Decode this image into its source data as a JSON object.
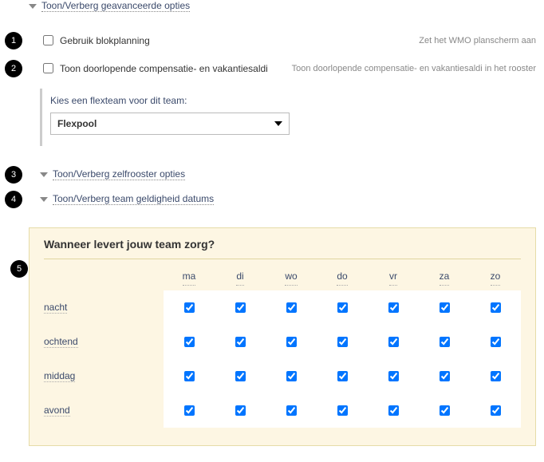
{
  "toggles": {
    "advanced": "Toon/Verberg geavanceerde opties",
    "selfroster": "Toon/Verberg zelfrooster opties",
    "validity": "Toon/Verberg team geldigheid datums"
  },
  "options": {
    "block": {
      "label": "Gebruik blokplanning",
      "hint": "Zet het WMO planscherm aan",
      "checked": false
    },
    "comp": {
      "label": "Toon doorlopende compensatie- en vakantiesaldi",
      "hint": "Toon doorlopende compensatie- en vakantiesaldi in het rooster",
      "checked": false
    }
  },
  "flex": {
    "prompt": "Kies een flexteam voor dit team:",
    "value": "Flexpool"
  },
  "panel": {
    "title": "Wanneer levert jouw team zorg?",
    "days": [
      "ma",
      "di",
      "wo",
      "do",
      "vr",
      "za",
      "zo"
    ],
    "periods": [
      "nacht",
      "ochtend",
      "middag",
      "avond"
    ]
  },
  "badges": {
    "b1": "1",
    "b2": "2",
    "b3": "3",
    "b4": "4",
    "b5": "5"
  }
}
